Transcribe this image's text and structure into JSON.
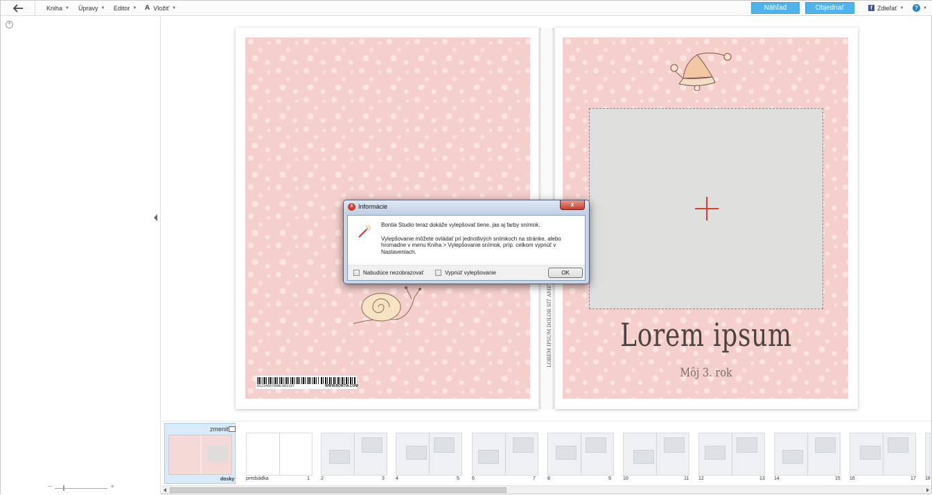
{
  "menu": {
    "items": [
      {
        "label": "Kniha"
      },
      {
        "label": "Úpravy"
      },
      {
        "label": "Editor"
      },
      {
        "label": "Vložiť"
      }
    ],
    "preview_button": "Náhľad",
    "order_button": "Objednať",
    "share_label": "Zdieľať",
    "fb_glyph": "f",
    "help_glyph": "?"
  },
  "dialog": {
    "title": "Informácie",
    "close_glyph": "x",
    "line1": "Bontia Studio teraz dokáže vylepšovať tiene, jas aj farby snímok.",
    "line2": "Vylepšovanie môžete ovládať pri jednotlivých snímkoch na stránke, alebo hromadne v menu Kniha > Vylepšovanie snímok, príp. celkom vypnúť v Nastaveniach.",
    "checkbox1": "Nabudúce nezobrazovať",
    "checkbox2": "Vypnúť vylepšovanie",
    "ok": "OK",
    "icon": "magic-wand-icon"
  },
  "cover": {
    "title": "Lorem ipsum",
    "subtitle": "Môj 3. rok",
    "spine_text": "LOREM IPSUM DOLOR SIT AMET",
    "barcode_number": "012345678ONL001337",
    "barcode_url": "WWW.BONTIA.COM",
    "background_color": "#f5cfcc",
    "dot_color": "#fbe4e2"
  },
  "strip": {
    "change_label": "zmeniť",
    "thumbnails": [
      {
        "left_label": "",
        "right_label": "doskу"
      },
      {
        "left_label": "predsádka",
        "right_label": "1"
      },
      {
        "left_label": "2",
        "right_label": "3"
      },
      {
        "left_label": "4",
        "right_label": "5"
      },
      {
        "left_label": "6",
        "right_label": "7"
      },
      {
        "left_label": "8",
        "right_label": "9"
      },
      {
        "left_label": "10",
        "right_label": "11"
      },
      {
        "left_label": "12",
        "right_label": "13"
      },
      {
        "left_label": "14",
        "right_label": "15"
      },
      {
        "left_label": "16",
        "right_label": "17"
      },
      {
        "left_label": "18",
        "right_label": ""
      }
    ]
  },
  "colors": {
    "accent_blue": "#4db3ea",
    "dialog_close_red": "#c3402d",
    "photo_plus_red": "#e23a2f"
  }
}
